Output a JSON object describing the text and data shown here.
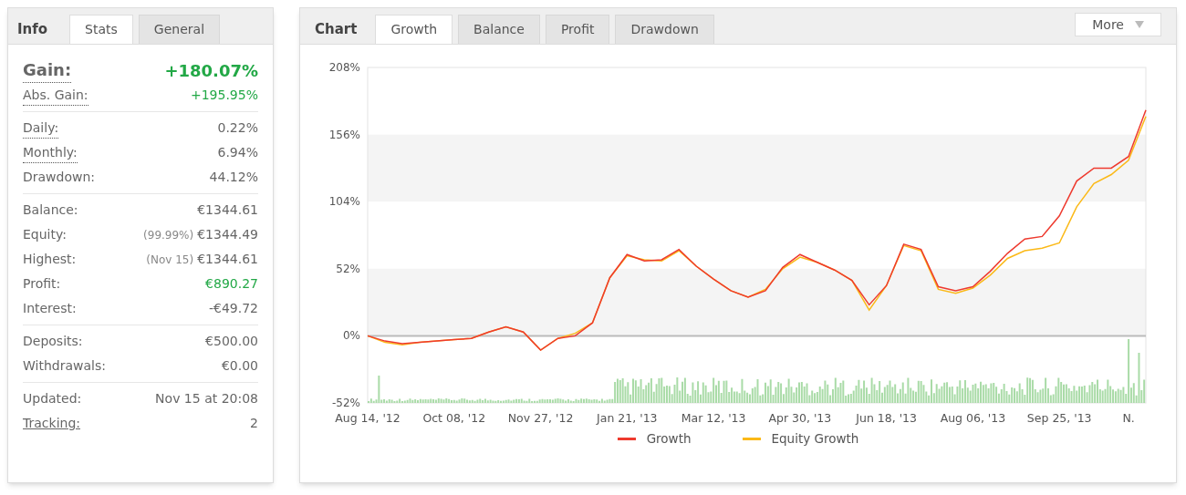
{
  "info_panel": {
    "title": "Info",
    "tabs": [
      {
        "label": "Stats",
        "selected": true
      },
      {
        "label": "General",
        "selected": false
      }
    ],
    "groups": [
      [
        {
          "kind": "headline",
          "label": "Gain:",
          "dotted": true,
          "link": false,
          "value": "+180.07%",
          "positive": true
        },
        {
          "kind": "normal",
          "label": "Abs. Gain:",
          "dotted": true,
          "link": false,
          "value": "+195.95%",
          "positive": true
        }
      ],
      [
        {
          "kind": "normal",
          "label": "Daily:",
          "dotted": true,
          "link": false,
          "value": "0.22%",
          "positive": false
        },
        {
          "kind": "normal",
          "label": "Monthly:",
          "dotted": true,
          "link": false,
          "value": "6.94%",
          "positive": false
        },
        {
          "kind": "normal",
          "label": "Drawdown:",
          "dotted": false,
          "link": false,
          "value": "44.12%",
          "positive": false
        }
      ],
      [
        {
          "kind": "normal",
          "label": "Balance:",
          "dotted": false,
          "link": false,
          "value": "€1344.61",
          "positive": false
        },
        {
          "kind": "normal",
          "label": "Equity:",
          "dotted": false,
          "link": false,
          "note": "(99.99%)",
          "value": "€1344.49",
          "positive": false
        },
        {
          "kind": "normal",
          "label": "Highest:",
          "dotted": false,
          "link": false,
          "note": "(Nov 15)",
          "value": "€1344.61",
          "positive": false
        },
        {
          "kind": "normal",
          "label": "Profit:",
          "dotted": false,
          "link": false,
          "value": "€890.27",
          "positive": true
        },
        {
          "kind": "normal",
          "label": "Interest:",
          "dotted": false,
          "link": false,
          "value": "-€49.72",
          "positive": false
        }
      ],
      [
        {
          "kind": "normal",
          "label": "Deposits:",
          "dotted": false,
          "link": false,
          "value": "€500.00",
          "positive": false
        },
        {
          "kind": "normal",
          "label": "Withdrawals:",
          "dotted": false,
          "link": false,
          "value": "€0.00",
          "positive": false
        }
      ],
      [
        {
          "kind": "normal",
          "label": "Updated:",
          "dotted": false,
          "link": false,
          "value": "Nov 15 at 20:08",
          "positive": false
        },
        {
          "kind": "normal",
          "label": "Tracking:",
          "dotted": false,
          "link": true,
          "value": "2",
          "positive": false
        }
      ]
    ]
  },
  "chart_panel": {
    "title": "Chart",
    "tabs": [
      {
        "label": "Growth",
        "selected": true
      },
      {
        "label": "Balance",
        "selected": false
      },
      {
        "label": "Profit",
        "selected": false
      },
      {
        "label": "Drawdown",
        "selected": false
      }
    ],
    "more_button": "More",
    "chart_data": {
      "type": "line",
      "categories": [
        "Aug 14, '12",
        null,
        null,
        null,
        null,
        "Oct 08, '12",
        null,
        null,
        null,
        null,
        "Nov 27, '12",
        null,
        null,
        null,
        null,
        "Jan 21, '13",
        null,
        null,
        null,
        null,
        "Mar 12, '13",
        null,
        null,
        null,
        null,
        "Apr 30, '13",
        null,
        null,
        null,
        null,
        "Jun 18, '13",
        null,
        null,
        null,
        null,
        "Aug 06, '13",
        null,
        null,
        null,
        null,
        "Sep 25, '13",
        null,
        null,
        null,
        "N.",
        null
      ],
      "series": [
        {
          "name": "Growth",
          "color": "#ee3a2e",
          "values": [
            0,
            -4,
            -6,
            -5,
            -4,
            -3,
            -2,
            3,
            7,
            3,
            -11,
            -2,
            0,
            10,
            45,
            63,
            58,
            59,
            67,
            54,
            44,
            35,
            30,
            35,
            53,
            63,
            57,
            51,
            43,
            24,
            39,
            71,
            67,
            38,
            35,
            38,
            50,
            64,
            75,
            77,
            93,
            120,
            130,
            130,
            139,
            175
          ]
        },
        {
          "name": "Equity Growth",
          "color": "#fbb917",
          "values": [
            0,
            -5,
            -7,
            -5,
            -4,
            -3,
            -2,
            3,
            7,
            3,
            -11,
            -2,
            2,
            10,
            45,
            62,
            59,
            58,
            66,
            54,
            44,
            35,
            30,
            36,
            52,
            61,
            57,
            51,
            43,
            20,
            39,
            70,
            66,
            36,
            33,
            37,
            47,
            60,
            66,
            68,
            72,
            100,
            118,
            125,
            136,
            170
          ]
        }
      ],
      "legend": true,
      "ylim": [
        -52,
        208
      ],
      "yticks": [
        {
          "value": -52,
          "label": "-52%"
        },
        {
          "value": 0,
          "label": "0%"
        },
        {
          "value": 52,
          "label": "52%"
        },
        {
          "value": 104,
          "label": "104%"
        },
        {
          "value": 156,
          "label": "156%"
        },
        {
          "value": 208,
          "label": "208%"
        }
      ]
    }
  }
}
